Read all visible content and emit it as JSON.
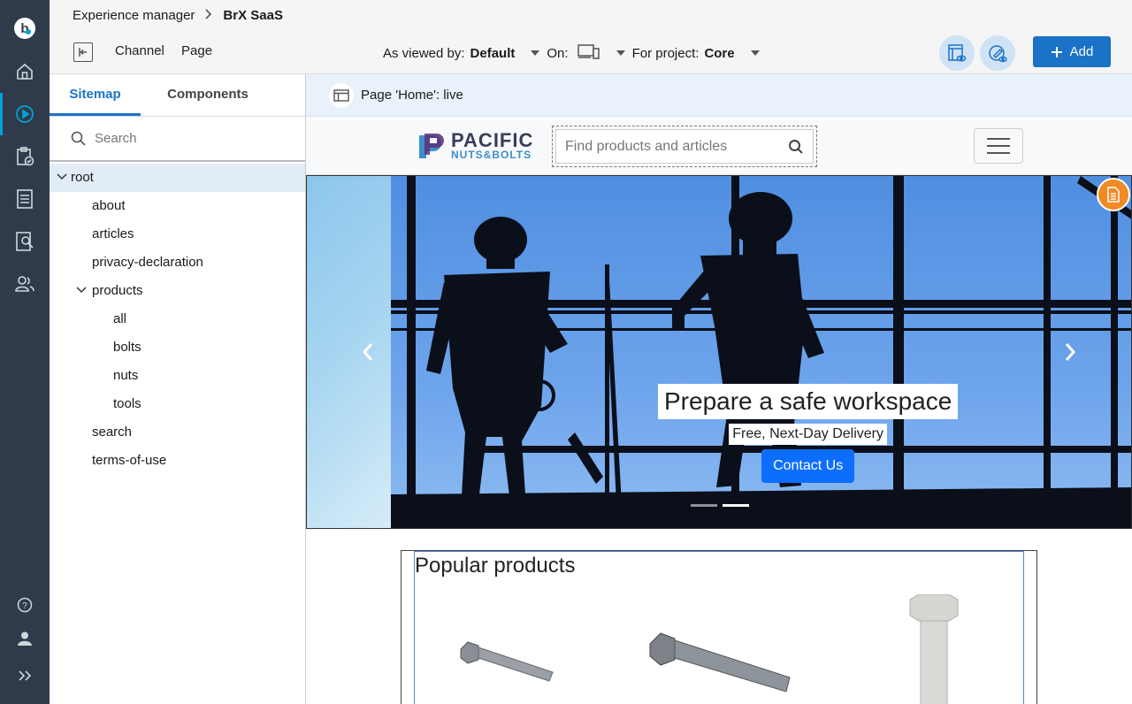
{
  "breadcrumb": {
    "app": "Experience manager",
    "current": "BrX SaaS"
  },
  "toolbar": {
    "channel_label": "Channel",
    "page_label": "Page",
    "viewed_by_label": "As viewed by:",
    "viewed_by_value": "Default",
    "on_label": "On:",
    "project_label": "For project:",
    "project_value": "Core",
    "add_label": "Add"
  },
  "sidebar": {
    "tabs": [
      {
        "label": "Sitemap"
      },
      {
        "label": "Components"
      }
    ],
    "search_placeholder": "Search",
    "tree": [
      {
        "label": "root"
      },
      {
        "label": "about"
      },
      {
        "label": "articles"
      },
      {
        "label": "privacy-declaration"
      },
      {
        "label": "products"
      },
      {
        "label": "all"
      },
      {
        "label": "bolts"
      },
      {
        "label": "nuts"
      },
      {
        "label": "tools"
      },
      {
        "label": "search"
      },
      {
        "label": "terms-of-use"
      }
    ]
  },
  "preview": {
    "status": "Page 'Home': live",
    "logo_word1": "PACIFIC",
    "logo_word2": "NUTS&BOLTS",
    "search_placeholder": "Find products and articles",
    "hero_title": "Prepare a safe workspace",
    "hero_subtitle": "Free, Next-Day Delivery",
    "hero_button": "Contact Us",
    "section_title": "Popular products"
  },
  "colors": {
    "rail": "#2f3b4a",
    "accent": "#1a73c7",
    "hero_button": "#0d6efd",
    "badge": "#f08a24"
  }
}
